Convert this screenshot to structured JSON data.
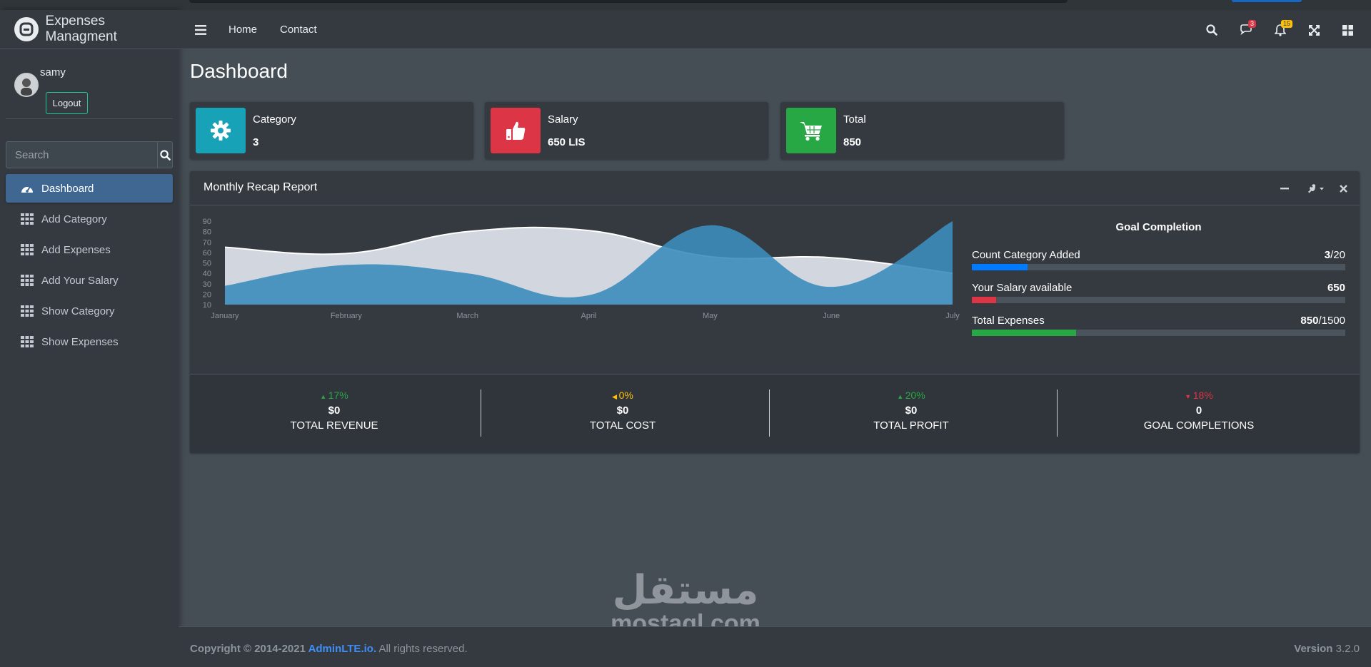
{
  "app": {
    "title": "Expenses Managment"
  },
  "user": {
    "name": "samy",
    "logout_label": "Logout"
  },
  "sidebar": {
    "search_placeholder": "Search",
    "items": [
      {
        "label": "Dashboard",
        "icon": "tachometer-icon",
        "active": true
      },
      {
        "label": "Add Category",
        "icon": "grid-icon"
      },
      {
        "label": "Add Expenses",
        "icon": "grid-icon"
      },
      {
        "label": "Add Your Salary",
        "icon": "grid-icon"
      },
      {
        "label": "Show Category",
        "icon": "grid-icon"
      },
      {
        "label": "Show Expenses",
        "icon": "grid-icon"
      }
    ]
  },
  "navbar": {
    "links": [
      "Home",
      "Contact"
    ],
    "messages_badge": "3",
    "notifications_badge": "15"
  },
  "page": {
    "title": "Dashboard"
  },
  "info_boxes": [
    {
      "label": "Category",
      "value": "3",
      "color": "#17a2b8",
      "icon": "gear-icon"
    },
    {
      "label": "Salary",
      "value": "650 LIS",
      "color": "#dc3545",
      "icon": "thumbs-up-icon"
    },
    {
      "label": "Total",
      "value": "850",
      "color": "#28a745",
      "icon": "cart-icon"
    }
  ],
  "report": {
    "title": "Monthly Recap Report",
    "goal": {
      "title": "Goal Completion",
      "items": [
        {
          "label": "Count Category Added",
          "value": "3",
          "total": "/20",
          "progress": 0.15,
          "color": "#007bff"
        },
        {
          "label": "Your Salary available",
          "value": "650",
          "total": "",
          "progress": 0.065,
          "color": "#dc3545"
        },
        {
          "label": "Total Expenses",
          "value": "850",
          "total": "/1500",
          "progress": 0.28,
          "color": "#28a745"
        }
      ]
    },
    "stats": [
      {
        "pct": "17%",
        "dir": "up",
        "color": "#28a745",
        "value": "$0",
        "label": "TOTAL REVENUE"
      },
      {
        "pct": "0%",
        "dir": "left",
        "color": "#ffc107",
        "value": "$0",
        "label": "TOTAL COST"
      },
      {
        "pct": "20%",
        "dir": "up",
        "color": "#28a745",
        "value": "$0",
        "label": "TOTAL PROFIT"
      },
      {
        "pct": "18%",
        "dir": "down",
        "color": "#dc3545",
        "value": "0",
        "label": "GOAL COMPLETIONS"
      }
    ]
  },
  "chart_data": {
    "type": "area",
    "categories": [
      "January",
      "February",
      "March",
      "April",
      "May",
      "June",
      "July"
    ],
    "y_ticks": [
      10,
      20,
      30,
      40,
      50,
      60,
      70,
      80,
      90
    ],
    "ylim": [
      10,
      90
    ],
    "series": [
      {
        "values": [
          65,
          59,
          80,
          81,
          56,
          55,
          40
        ],
        "color": "#d2d6de"
      },
      {
        "values": [
          28,
          48,
          40,
          19,
          86,
          27,
          90
        ],
        "color": "#3c8dbc"
      }
    ],
    "grid": false,
    "legend": "none"
  },
  "footer": {
    "copyright": "Copyright © 2014-2021 ",
    "link": "AdminLTE.io.",
    "rights": " All rights reserved.",
    "version_label": "Version",
    "version": " 3.2.0"
  },
  "watermark": {
    "arabic": "مستقل",
    "latin": "mostaql.com"
  }
}
